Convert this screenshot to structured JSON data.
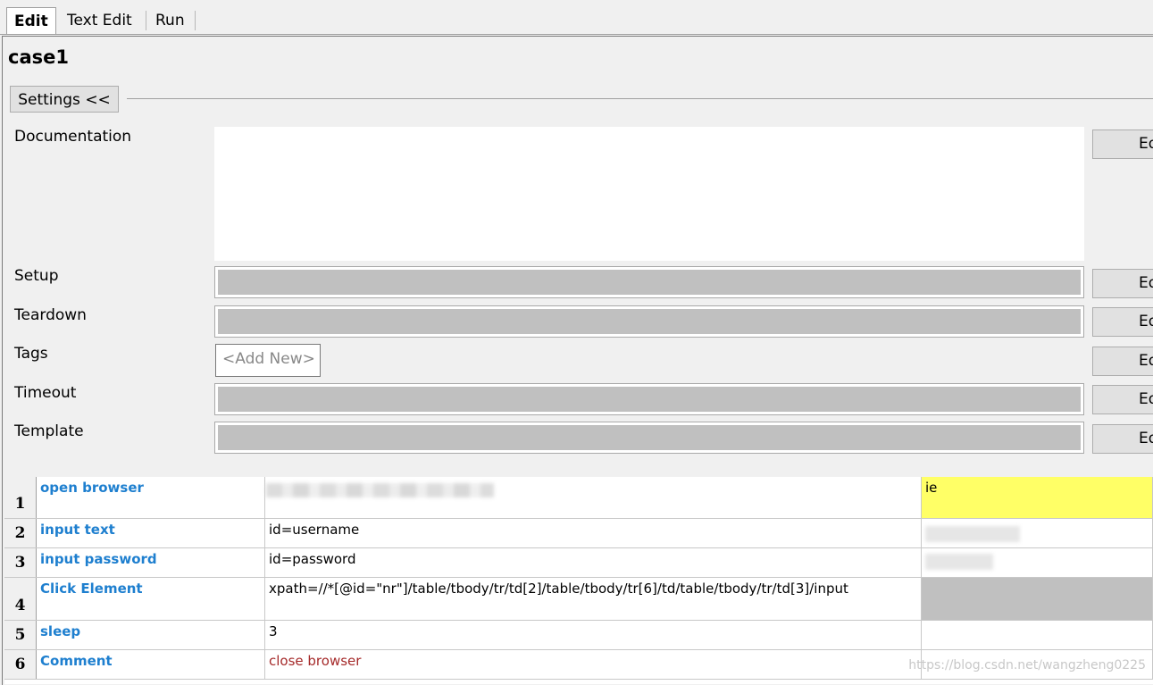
{
  "tabs": [
    {
      "label": "Edit",
      "active": true
    },
    {
      "label": "Text Edit",
      "active": false
    },
    {
      "label": "Run",
      "active": false
    }
  ],
  "case_name": "case1",
  "settings_toggle": "Settings <<",
  "fields": {
    "documentation": "Documentation",
    "setup": "Setup",
    "teardown": "Teardown",
    "tags": "Tags",
    "timeout": "Timeout",
    "template": "Template"
  },
  "tags_placeholder": "<Add New>",
  "edit_label": "Edit",
  "steps": [
    {
      "num": "1",
      "keyword": "open browser",
      "arg1": "",
      "arg2": "ie"
    },
    {
      "num": "2",
      "keyword": "input text",
      "arg1": "id=username",
      "arg2": ""
    },
    {
      "num": "3",
      "keyword": "input password",
      "arg1": "id=password",
      "arg2": ""
    },
    {
      "num": "4",
      "keyword": "Click Element",
      "arg1": "xpath=//*[@id=\"nr\"]/table/tbody/tr/td[2]/table/tbody/tr[6]/td/table/tbody/tr/td[3]/input",
      "arg2": ""
    },
    {
      "num": "5",
      "keyword": "sleep",
      "arg1": "3",
      "arg2": ""
    },
    {
      "num": "6",
      "keyword": "Comment",
      "arg1": "close browser",
      "arg2": ""
    }
  ],
  "watermark": "https://blog.csdn.net/wangzheng0225",
  "colors": {
    "keyword": "#1e7fcf",
    "highlight": "#ffff66",
    "comment": "#a52a2a",
    "disabled_field": "#c0c0c0"
  }
}
